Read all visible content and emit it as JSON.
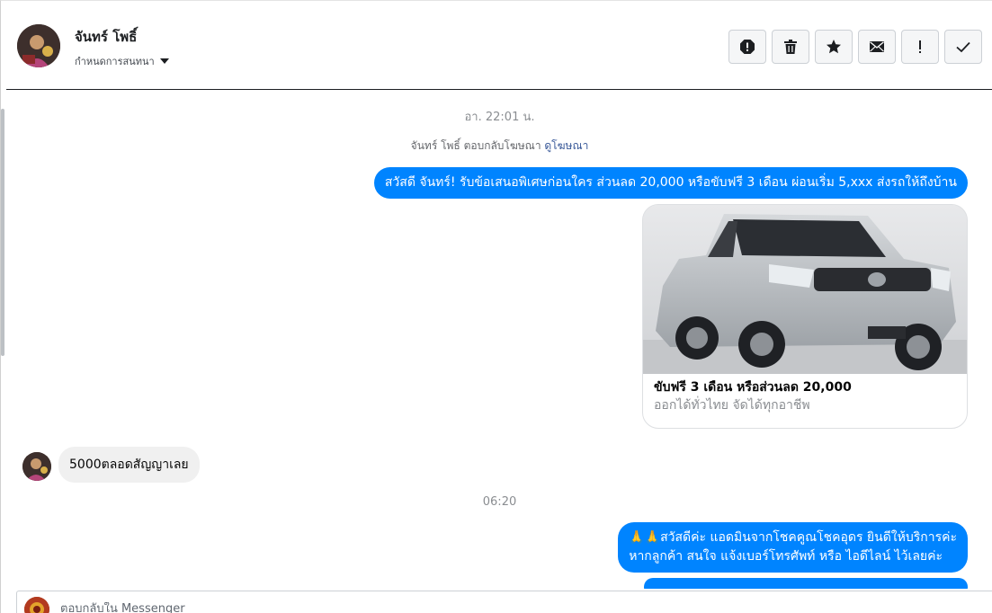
{
  "header": {
    "contact_name": "จันทร์ โพธิ์",
    "subtitle": "กำหนดการสนทนา",
    "toolbar": [
      {
        "name": "report-icon",
        "label": "report"
      },
      {
        "name": "trash-icon",
        "label": "delete"
      },
      {
        "name": "star-icon",
        "label": "star"
      },
      {
        "name": "envelope-icon",
        "label": "mark unread"
      },
      {
        "name": "exclamation-icon",
        "label": "flag"
      },
      {
        "name": "checkmark-icon",
        "label": "done"
      }
    ]
  },
  "conversation": {
    "timestamp_1": "อา. 22:01 น.",
    "ad_reply_text": "จันทร์ โพธิ์ ตอบกลับโฆษณา",
    "ad_reply_link": "ดูโฆษณา",
    "message_1": "สวัสดี จันทร์! รับข้อเสนอพิเศษก่อนใคร ส่วนลด 20,000 หรือขับฟรี 3 เดือน ผ่อนเริ่ม 5,xxx ส่งรถให้ถึงบ้าน",
    "card": {
      "title": "ขับฟรี 3 เดือน หรือส่วนลด 20,000",
      "subtitle": "ออกได้ทั่วไทย จัดได้ทุกอาชีพ"
    },
    "incoming_message": "5000ตลอดสัญญาเลย",
    "timestamp_2": "06:20",
    "message_2_line_1": "🙏🙏สวัสดีค่ะ แอดมินจากโชคคูณโชคอุดร ยินดีให้บริการค่ะ",
    "message_2_line_2": "หากลูกค้า สนใจ แจ้งเบอร์โทรศัพท์ หรือ ไอดีไลน์  ไว้เลยค่ะ"
  },
  "composer": {
    "placeholder": "ตอบกลับใน Messenger"
  },
  "colors": {
    "outgoing_bubble": "#0084ff",
    "incoming_bubble": "#f0f0f0",
    "link": "#385898"
  }
}
